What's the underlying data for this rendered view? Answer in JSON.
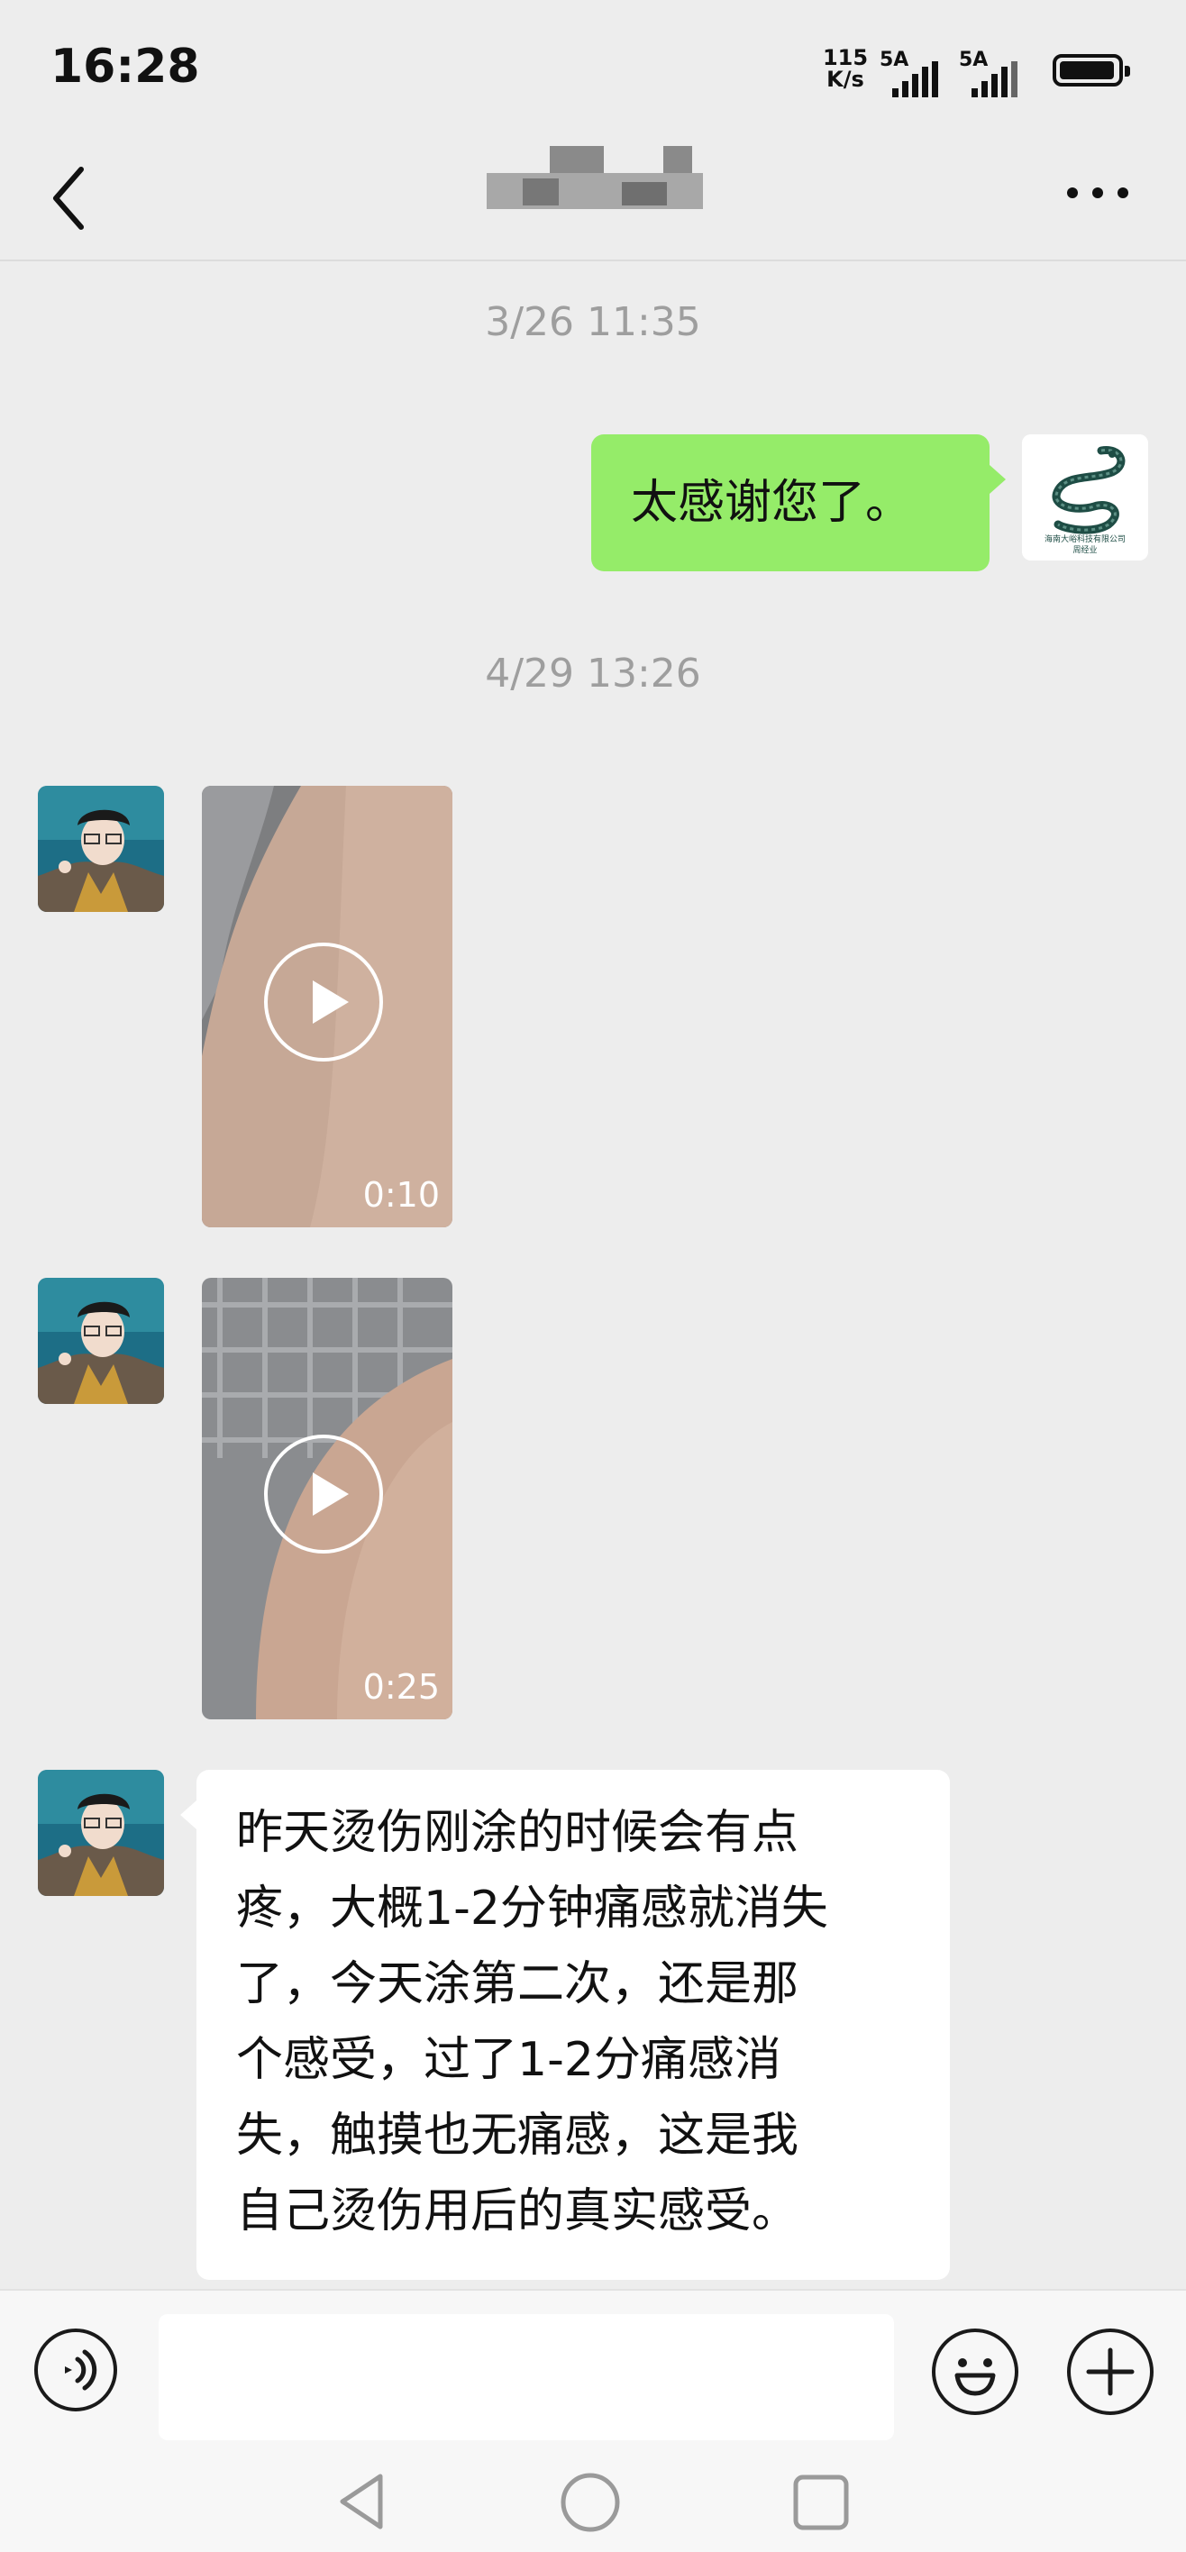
{
  "status_bar": {
    "time": "16:28",
    "net_speed_value": "115",
    "net_speed_unit": "K/s",
    "signal_1_label": "5A",
    "signal_2_label": "5A"
  },
  "chat": {
    "timestamps": [
      "3/26 11:35",
      "4/29 13:26"
    ],
    "messages": [
      {
        "sender": "me",
        "type": "text",
        "text": "太感谢您了。"
      },
      {
        "sender": "other",
        "type": "video",
        "duration": "0:10"
      },
      {
        "sender": "other",
        "type": "video",
        "duration": "0:25"
      },
      {
        "sender": "other",
        "type": "text",
        "lines": [
          "昨天烫伤刚涂的时候会有点",
          "疼，大概1-2分钟痛感就消失",
          "了，今天涂第二次，还是那",
          "个感受，过了1-2分痛感消",
          "失，触摸也无痛感，这是我",
          "自己烫伤用后的真实感受。"
        ]
      }
    ],
    "my_avatar_caption_1": "海南大峪科技有限公司",
    "my_avatar_caption_2": "周经业"
  },
  "input": {
    "value": "",
    "placeholder": ""
  },
  "colors": {
    "my_bubble": "#95ec69",
    "other_bubble": "#ffffff",
    "background": "#ededed"
  }
}
